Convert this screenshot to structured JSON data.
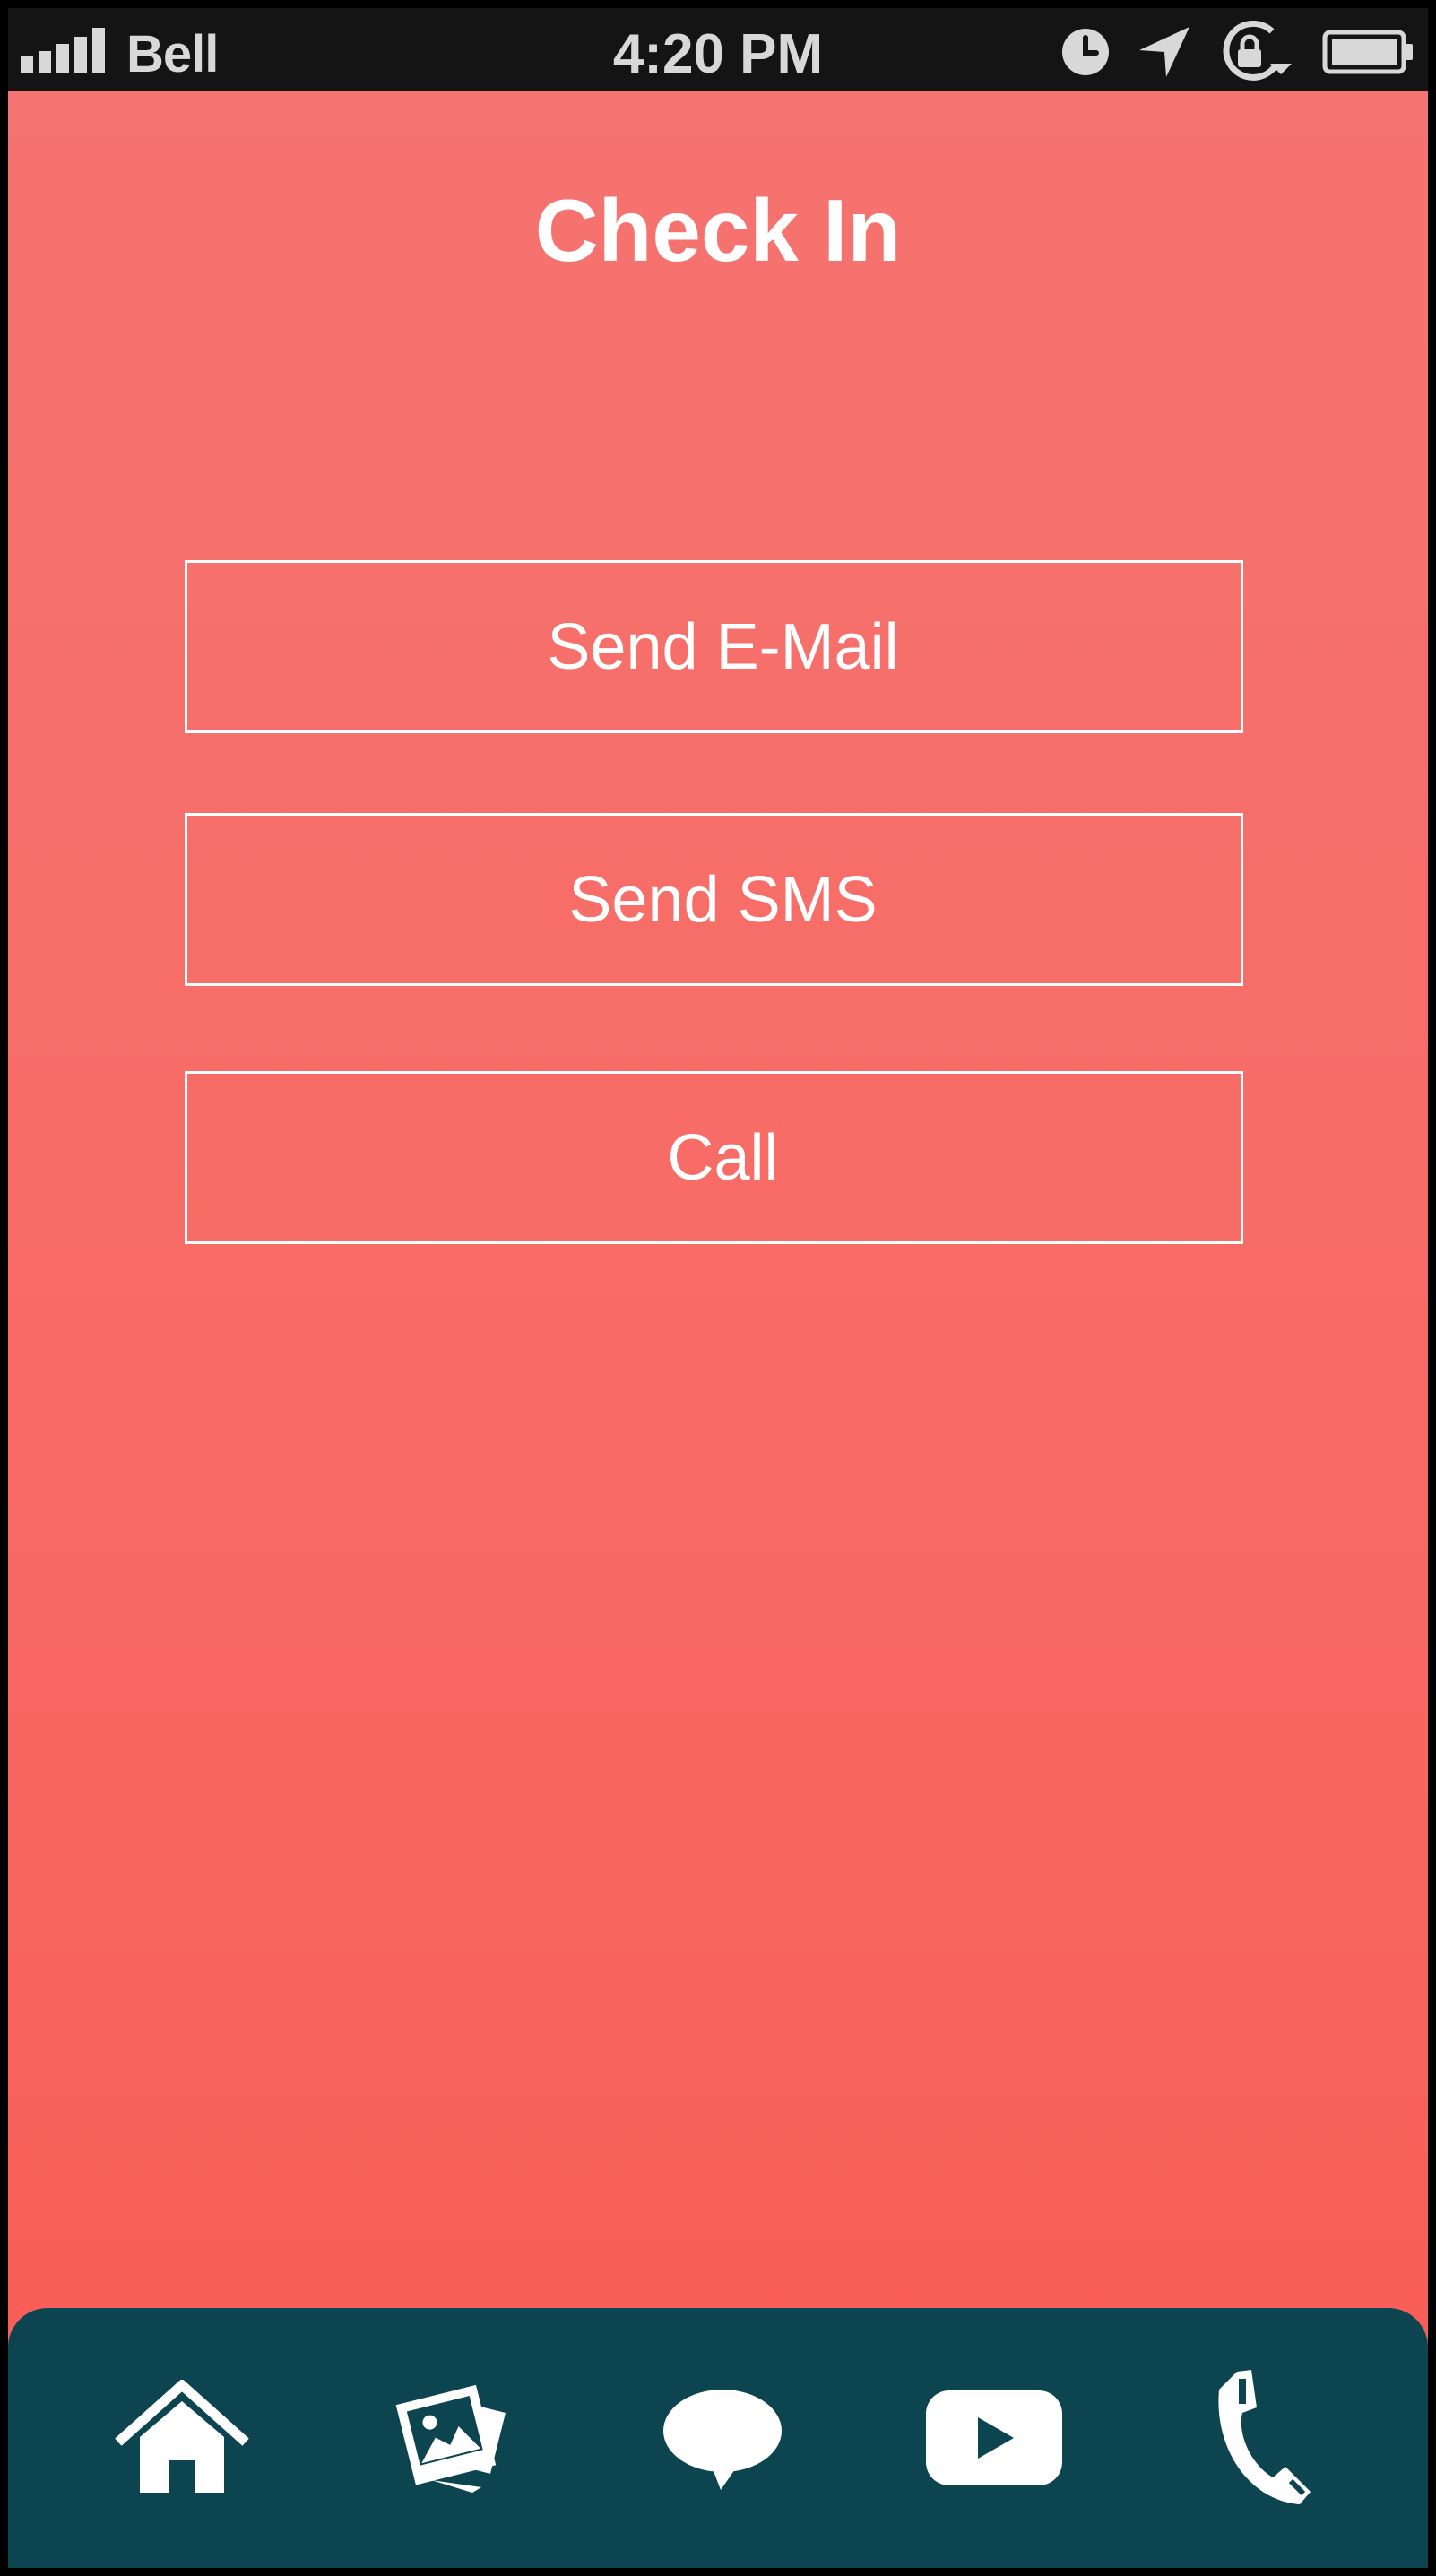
{
  "status_bar": {
    "carrier": "Bell",
    "time": "4:20 PM",
    "icons": [
      "signal-icon",
      "clock-icon",
      "location-arrow-icon",
      "rotation-lock-icon",
      "battery-icon"
    ]
  },
  "page": {
    "title": "Check In",
    "background_top": "#f57370",
    "background_bottom": "#f95b55"
  },
  "actions": {
    "email_label": "Send E-Mail",
    "sms_label": "Send SMS",
    "call_label": "Call"
  },
  "tab_bar": {
    "background": "#0c4450",
    "items": [
      {
        "icon": "home-icon"
      },
      {
        "icon": "photos-icon"
      },
      {
        "icon": "chat-bubble-icon"
      },
      {
        "icon": "video-play-icon"
      },
      {
        "icon": "phone-icon"
      }
    ]
  }
}
